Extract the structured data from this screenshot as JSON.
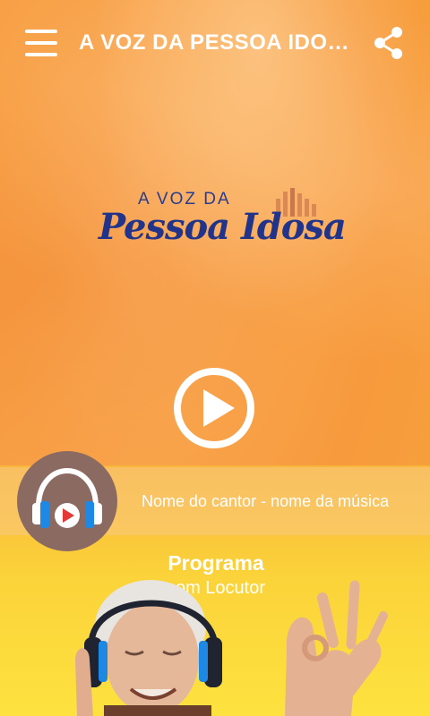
{
  "app": {
    "title": "A VOZ DA PESSOA IDO…"
  },
  "logo": {
    "top_text": "A VOZ DA",
    "main_text": "Pessoa Idosa"
  },
  "player": {
    "now_playing": "Nome do cantor - nome da música"
  },
  "program": {
    "title": "Programa",
    "host": "com Locutor"
  },
  "colors": {
    "logo_blue": "#22348a",
    "accent_orange": "#f7a34a",
    "headphones_blue": "#1e88e5",
    "avatar_brown": "#8b6a62"
  },
  "icons": {
    "menu": "menu-icon",
    "share": "share-icon",
    "play": "play-icon",
    "headphones": "headphones-icon"
  }
}
